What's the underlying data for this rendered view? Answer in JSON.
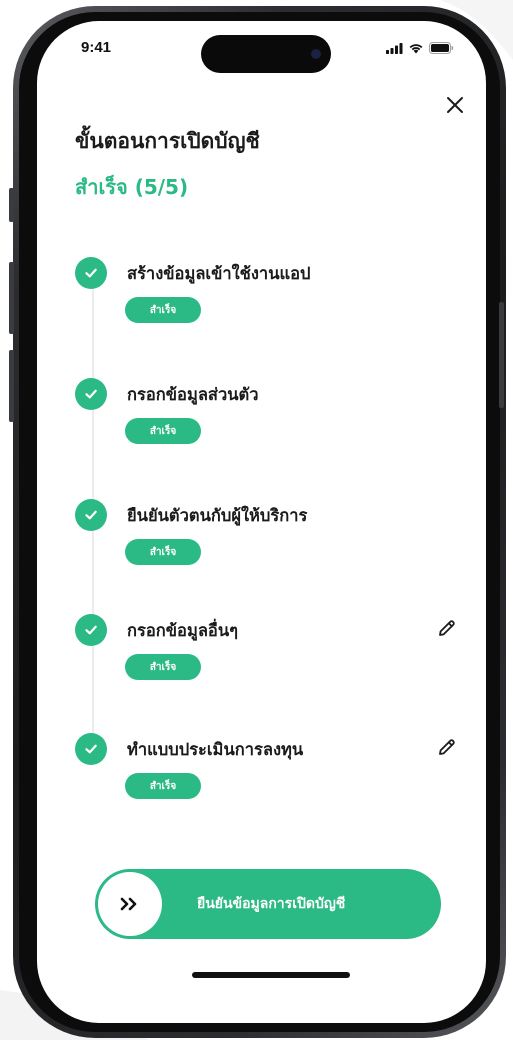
{
  "status_bar": {
    "time": "9:41",
    "icons": [
      "cellular-signal-icon",
      "wifi-icon",
      "battery-icon"
    ]
  },
  "header": {
    "title": "ขั้นตอนการเปิดบัญชี",
    "progress_text": "สำเร็จ (5/5)"
  },
  "steps": [
    {
      "label": "สร้างข้อมูลเข้าใช้งานแอป",
      "status": "สำเร็จ",
      "editable": false
    },
    {
      "label": "กรอกข้อมูลส่วนตัว",
      "status": "สำเร็จ",
      "editable": false
    },
    {
      "label": "ยืนยันตัวตนกับผู้ให้บริการ",
      "status": "สำเร็จ",
      "editable": false
    },
    {
      "label": "กรอกข้อมูลอื่นๆ",
      "status": "สำเร็จ",
      "editable": true
    },
    {
      "label": "ทำแบบประเมินการลงทุน",
      "status": "สำเร็จ",
      "editable": true
    }
  ],
  "confirm_button": {
    "label": "ยืนยันข้อมูลการเปิดบัญชี",
    "knob_icon": "double-chevron-right-icon"
  },
  "colors": {
    "accent": "#2bba86",
    "text": "#1b1b1b"
  }
}
